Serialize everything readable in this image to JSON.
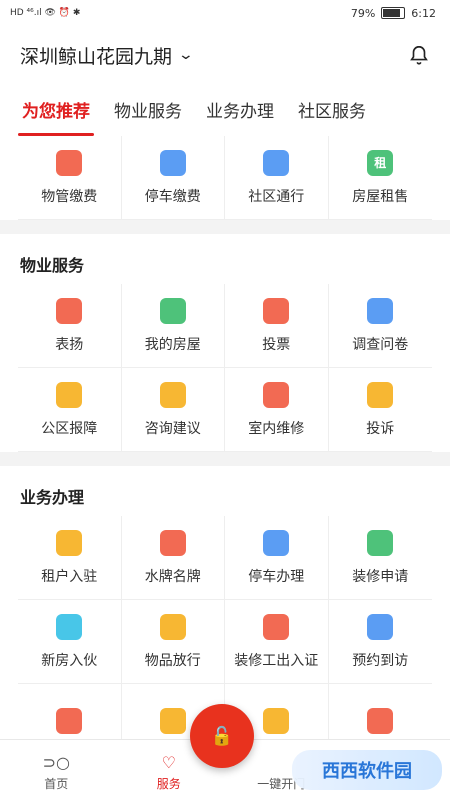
{
  "status": {
    "left": "HD ⁴⁶.ıl 👁 ⏰ ✱",
    "battery": "79%",
    "time": "6:12"
  },
  "header": {
    "title": "深圳鲸山花园九期",
    "chevron": "⌄"
  },
  "tabs": [
    {
      "label": "为您推荐",
      "active": true
    },
    {
      "label": "物业服务",
      "active": false
    },
    {
      "label": "业务办理",
      "active": false
    },
    {
      "label": "社区服务",
      "active": false
    }
  ],
  "quick": [
    {
      "label": "物管缴费",
      "icon": "fee-icon",
      "color": "#f26a53"
    },
    {
      "label": "停车缴费",
      "icon": "parking-fee-icon",
      "color": "#5b9df3"
    },
    {
      "label": "社区通行",
      "icon": "pass-icon",
      "color": "#5b9df3"
    },
    {
      "label": "房屋租售",
      "icon": "rent-icon",
      "color": "#4ec27a",
      "glyph": "租"
    }
  ],
  "property": {
    "title": "物业服务",
    "items": [
      {
        "label": "表扬",
        "icon": "praise-icon",
        "color": "#f26a53"
      },
      {
        "label": "我的房屋",
        "icon": "house-icon",
        "color": "#4ec27a"
      },
      {
        "label": "投票",
        "icon": "vote-icon",
        "color": "#f26a53"
      },
      {
        "label": "调查问卷",
        "icon": "survey-icon",
        "color": "#5b9df3"
      },
      {
        "label": "公区报障",
        "icon": "report-icon",
        "color": "#f7b733"
      },
      {
        "label": "咨询建议",
        "icon": "consult-icon",
        "color": "#f7b733"
      },
      {
        "label": "室内维修",
        "icon": "repair-icon",
        "color": "#f26a53"
      },
      {
        "label": "投诉",
        "icon": "complaint-icon",
        "color": "#f7b733"
      }
    ]
  },
  "business": {
    "title": "业务办理",
    "items": [
      {
        "label": "租户入驻",
        "icon": "tenant-icon",
        "color": "#f7b733"
      },
      {
        "label": "水牌名牌",
        "icon": "sign-icon",
        "color": "#f26a53"
      },
      {
        "label": "停车办理",
        "icon": "parking-icon",
        "color": "#5b9df3"
      },
      {
        "label": "装修申请",
        "icon": "decor-icon",
        "color": "#4ec27a"
      },
      {
        "label": "新房入伙",
        "icon": "newhouse-icon",
        "color": "#48c6e8"
      },
      {
        "label": "物品放行",
        "icon": "goods-icon",
        "color": "#f7b733"
      },
      {
        "label": "装修工出入证",
        "icon": "worker-pass-icon",
        "color": "#f26a53"
      },
      {
        "label": "预约到访",
        "icon": "visit-icon",
        "color": "#5b9df3"
      },
      {
        "label": "",
        "icon": "more-icon-1",
        "color": "#f26a53"
      },
      {
        "label": "",
        "icon": "more-icon-2",
        "color": "#f7b733"
      },
      {
        "label": "",
        "icon": "more-icon-3",
        "color": "#f7b733"
      },
      {
        "label": "",
        "icon": "more-icon-4",
        "color": "#f26a53"
      }
    ]
  },
  "bottom": [
    {
      "label": "首页",
      "icon": "home-icon",
      "glyph": "⊃○"
    },
    {
      "label": "服务",
      "icon": "service-heart-icon",
      "glyph": "♡",
      "active": true
    },
    {
      "label": "一键开门",
      "icon": "unlock-icon"
    }
  ],
  "fab_glyph": "🔓",
  "watermark": "西西软件园"
}
